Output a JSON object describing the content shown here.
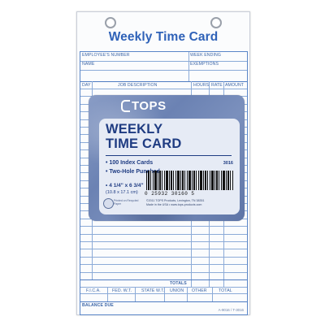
{
  "form": {
    "title": "Weekly Time Card",
    "employee_number_label": "EMPLOYEE'S NUMBER",
    "week_ending_label": "WEEK ENDING",
    "name_label": "NAME",
    "exemptions_label": "EXEMPTIONS",
    "columns": {
      "day": "DAY",
      "job_description": "JOB DESCRIPTION",
      "hours": "HOURS",
      "rate": "RATE",
      "amount": "AMOUNT"
    },
    "totals_label": "TOTALS",
    "deductions": [
      "F.I.C.A.",
      "FED. W.T.",
      "STATE W.T.",
      "UNION",
      "OTHER",
      "TOTAL"
    ],
    "balance_due_label": "BALANCE DUE",
    "doc_number": "A-9016 / T-3016"
  },
  "label": {
    "brand": "TOPS",
    "heading_line1": "WEEKLY",
    "heading_line2": "TIME CARD",
    "features": [
      "100 Index Cards",
      "Two-Hole Punched",
      "4 1/4\" x 6 3/4\"",
      "(10.8 x 17.1 cm)"
    ],
    "product_number": "3016",
    "barcode_number": "0 25932 30160 5",
    "fine_print_1": "©2011 TOPS Products, Lexington, TN 38351",
    "fine_print_2": "Made in the USA  •  www.tops-products.com",
    "seal_text": "Printed on Recycled Paper"
  },
  "colors": {
    "form_blue": "#2f62b8",
    "label_navy": "#1f3c82"
  }
}
